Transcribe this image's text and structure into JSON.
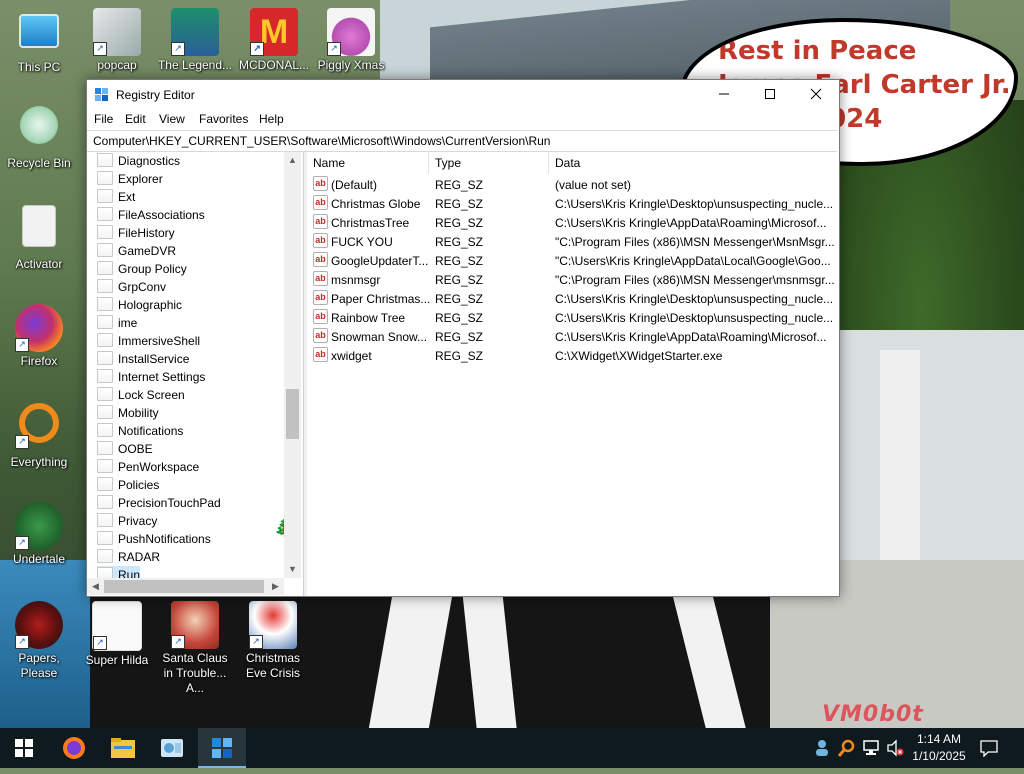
{
  "wallpaper": {
    "bubble_line1": "Rest in Peace",
    "bubble_line2": "James Earl Carter Jr.",
    "bubble_line3": "2024",
    "watermark": "VM0b0t"
  },
  "desktop_icons": [
    {
      "label": "This PC",
      "icon": "this-pc-icon"
    },
    {
      "label": "popcap",
      "icon": "popcap-icon"
    },
    {
      "label": "The Legend...",
      "icon": "legend-icon"
    },
    {
      "label": "MCDONAL...",
      "icon": "mcdonalds-icon"
    },
    {
      "label": "Piggly Xmas",
      "icon": "piggly-icon"
    },
    {
      "label": "Recycle Bin",
      "icon": "recycle-bin-icon"
    },
    {
      "label": "Activator",
      "icon": "activator-icon"
    },
    {
      "label": "Firefox",
      "icon": "firefox-icon"
    },
    {
      "label": "Everything",
      "icon": "everything-icon"
    },
    {
      "label": "Undertale",
      "icon": "undertale-icon"
    },
    {
      "label": "Papers, Please",
      "icon": "papers-please-icon"
    },
    {
      "label": "Super Hilda",
      "icon": "super-hilda-icon"
    },
    {
      "label": "Santa Claus in Trouble... A...",
      "icon": "santa-icon"
    },
    {
      "label": "Christmas Eve Crisis",
      "icon": "christmas-eve-icon"
    }
  ],
  "window": {
    "title": "Registry Editor",
    "menu": [
      "File",
      "Edit",
      "View",
      "Favorites",
      "Help"
    ],
    "address": "Computer\\HKEY_CURRENT_USER\\Software\\Microsoft\\Windows\\CurrentVersion\\Run",
    "tree_items": [
      "Diagnostics",
      "Explorer",
      "Ext",
      "FileAssociations",
      "FileHistory",
      "GameDVR",
      "Group Policy",
      "GrpConv",
      "Holographic",
      "ime",
      "ImmersiveShell",
      "InstallService",
      "Internet Settings",
      "Lock Screen",
      "Mobility",
      "Notifications",
      "OOBE",
      "PenWorkspace",
      "Policies",
      "PrecisionTouchPad",
      "Privacy",
      "PushNotifications",
      "RADAR",
      "Run"
    ],
    "columns": {
      "name": "Name",
      "type": "Type",
      "data": "Data"
    },
    "values": [
      {
        "name": "(Default)",
        "type": "REG_SZ",
        "data": "(value not set)"
      },
      {
        "name": "Christmas Globe",
        "type": "REG_SZ",
        "data": "C:\\Users\\Kris Kringle\\Desktop\\unsuspecting_nucle..."
      },
      {
        "name": "ChristmasTree",
        "type": "REG_SZ",
        "data": "C:\\Users\\Kris Kringle\\AppData\\Roaming\\Microsof..."
      },
      {
        "name": "FUCK YOU",
        "type": "REG_SZ",
        "data": "\"C:\\Program Files (x86)\\MSN Messenger\\MsnMsgr..."
      },
      {
        "name": "GoogleUpdaterT...",
        "type": "REG_SZ",
        "data": "\"C:\\Users\\Kris Kringle\\AppData\\Local\\Google\\Goo..."
      },
      {
        "name": "msnmsgr",
        "type": "REG_SZ",
        "data": "\"C:\\Program Files (x86)\\MSN Messenger\\msnmsgr..."
      },
      {
        "name": "Paper Christmas...",
        "type": "REG_SZ",
        "data": "C:\\Users\\Kris Kringle\\Desktop\\unsuspecting_nucle..."
      },
      {
        "name": "Rainbow Tree",
        "type": "REG_SZ",
        "data": "C:\\Users\\Kris Kringle\\Desktop\\unsuspecting_nucle..."
      },
      {
        "name": "Snowman Snow...",
        "type": "REG_SZ",
        "data": "C:\\Users\\Kris Kringle\\AppData\\Roaming\\Microsof..."
      },
      {
        "name": "xwidget",
        "type": "REG_SZ",
        "data": "C:\\XWidget\\XWidgetStarter.exe"
      }
    ]
  },
  "taskbar": {
    "clock_time": "1:14 AM",
    "clock_date": "1/10/2025",
    "apps": [
      "start-icon",
      "firefox-icon",
      "file-explorer-icon",
      "control-panel-icon",
      "registry-editor-icon"
    ]
  },
  "colors": {
    "accent": "#76b9ed",
    "bubble_text": "#c0392b",
    "taskbar": "#0f1a1f"
  }
}
